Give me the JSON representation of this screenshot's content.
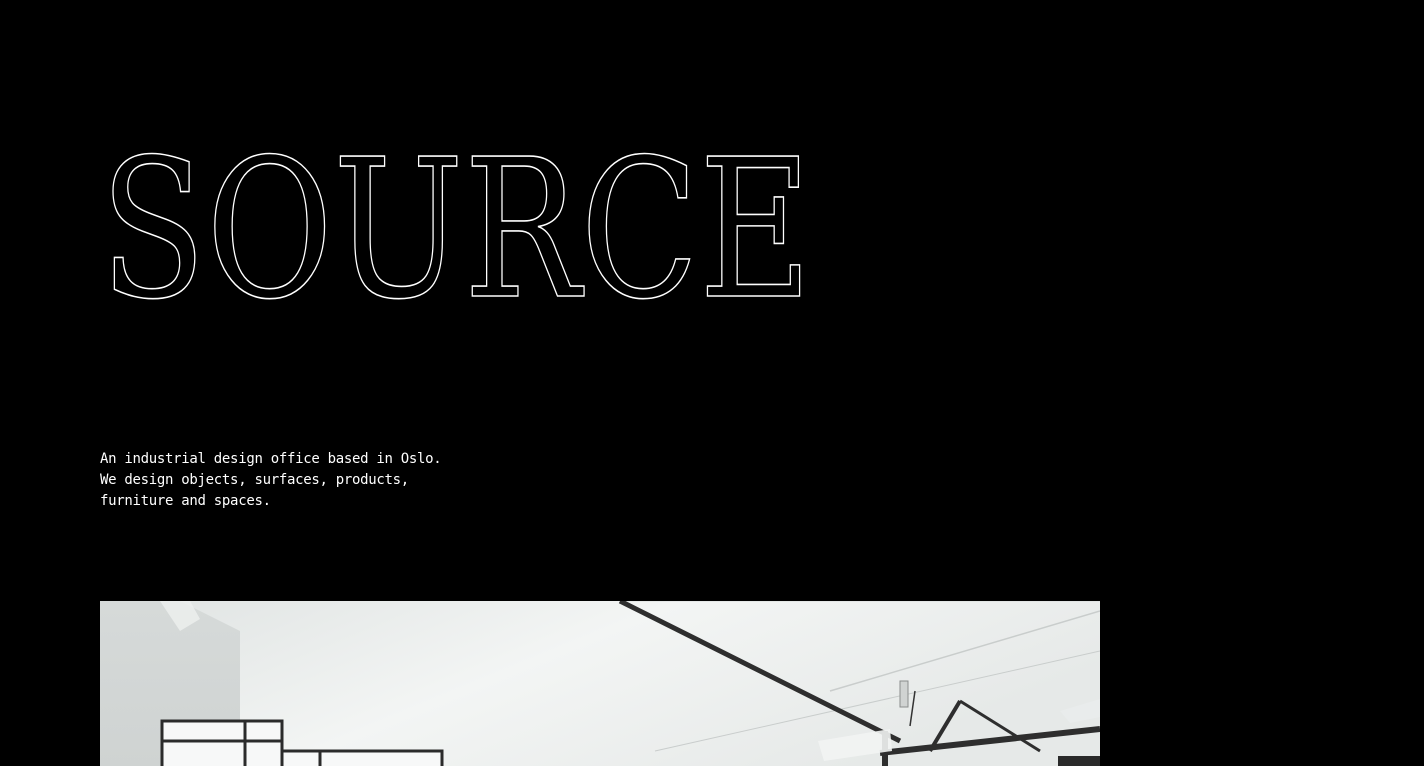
{
  "hero": {
    "title": "SOURCE",
    "title_color": "#ffffff"
  },
  "intro": {
    "lines": [
      "An industrial design office based in Oslo.",
      "We design objects, surfaces, products,",
      "furniture and spaces."
    ]
  },
  "colors": {
    "background": "#000000",
    "text": "#ffffff"
  },
  "image": {
    "subject": "studio interior with white ceiling, exposed pipes and windows"
  }
}
